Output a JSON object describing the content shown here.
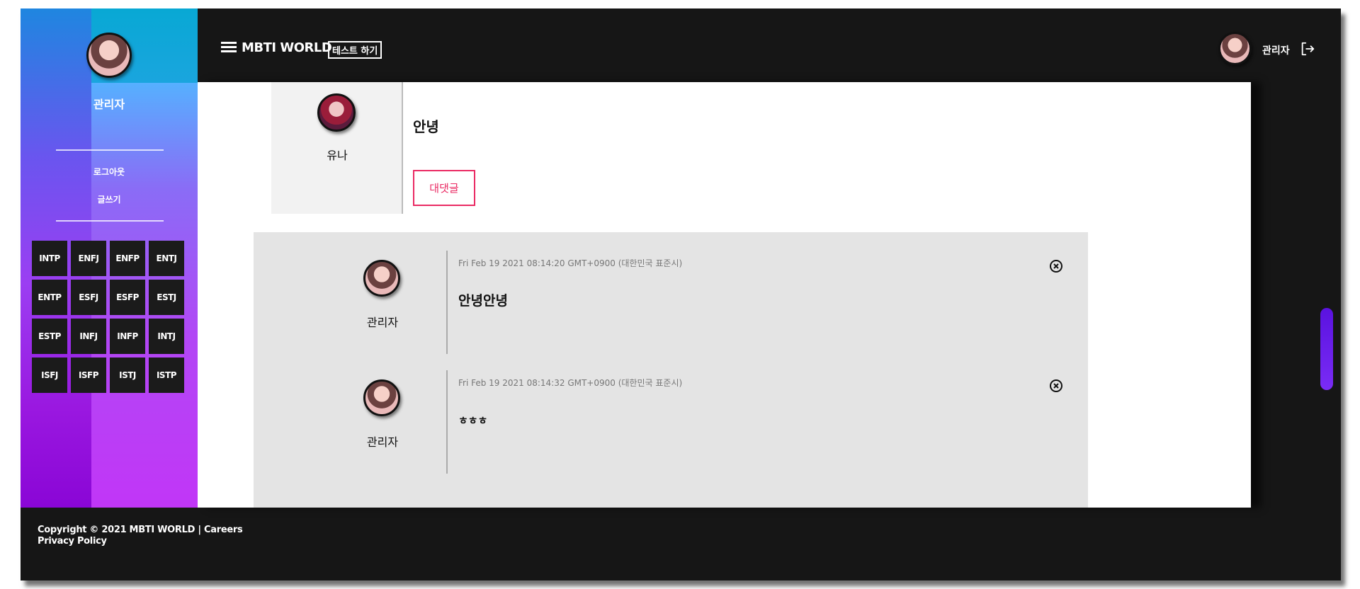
{
  "header": {
    "brand": "MBTI WORLD",
    "test_button": "테스트 하기",
    "user_name": "관리자"
  },
  "sidebar": {
    "user_name": "관리자",
    "links": [
      "로그아웃",
      "글쓰기"
    ],
    "mbti_types": [
      "INTP",
      "ENFJ",
      "ENFP",
      "ENTJ",
      "ENTP",
      "ESFJ",
      "ESFP",
      "ESTJ",
      "ESTP",
      "INFJ",
      "INFP",
      "INTJ",
      "ISFJ",
      "ISFP",
      "ISTJ",
      "ISTP"
    ]
  },
  "post": {
    "author": "유나",
    "text": "안녕",
    "reply_button": "대댓글"
  },
  "comments": [
    {
      "author": "관리자",
      "date": "Fri Feb 19 2021 08:14:20 GMT+0900 (대한민국 표준시)",
      "text": "안녕안녕"
    },
    {
      "author": "관리자",
      "date": "Fri Feb 19 2021 08:14:32 GMT+0900 (대한민국 표준시)",
      "text": "ㅎㅎㅎ"
    }
  ],
  "footer": {
    "copyright": "Copyright © 2021 MBTI WORLD | ",
    "careers": "Careers",
    "privacy": "Privacy Policy"
  },
  "colors": {
    "accent_pink": "#ea2a63",
    "header_bg": "#161616",
    "scroll_thumb": "#6a1ff0"
  }
}
